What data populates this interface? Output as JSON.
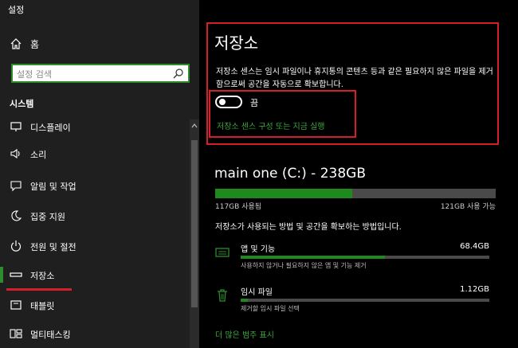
{
  "window": {
    "title": "설정"
  },
  "sidebar": {
    "home_label": "홈",
    "search_placeholder": "설정 검색",
    "section_title": "시스템",
    "items": [
      {
        "label": "디스플레이",
        "icon": "display-icon"
      },
      {
        "label": "소리",
        "icon": "speaker-icon"
      },
      {
        "label": "알림 및 작업",
        "icon": "notification-icon"
      },
      {
        "label": "집중 지원",
        "icon": "moon-icon"
      },
      {
        "label": "전원 및 절전",
        "icon": "power-icon"
      },
      {
        "label": "저장소",
        "icon": "storage-icon",
        "selected": true
      },
      {
        "label": "태블릿",
        "icon": "tablet-icon"
      },
      {
        "label": "멀티태스킹",
        "icon": "multitask-icon"
      }
    ]
  },
  "main": {
    "title": "저장소",
    "description": "저장소 센스는 임시 파일이나 휴지통의 콘텐츠 등과 같은 필요하지 않은 파일을 제거함으로써 공간을 자동으로 확보합니다.",
    "toggle": {
      "label": "끔",
      "on": false
    },
    "config_link": "저장소 센스 구성 또는 지금 실행",
    "drive": {
      "title": "main one (C:) - 238GB",
      "used_label": "117GB 사용됨",
      "free_label": "121GB 사용 가능",
      "used_fraction": 0.49
    },
    "usage_description": "저장소가 사용되는 방법 및 공간을 확보하는 방법입니다.",
    "categories": [
      {
        "name": "앱 및 기능",
        "size": "68.4GB",
        "sub": "사용하지 않거나 필요하지 않은 앱 및 기능 제거",
        "fraction": 0.58,
        "icon": "apps-icon"
      },
      {
        "name": "임시 파일",
        "size": "1.12GB",
        "sub": "제거할 임시 파일 선택",
        "fraction": 0.03,
        "icon": "trash-icon"
      }
    ],
    "more_link": "더 많은 범주 표시"
  },
  "colors": {
    "accent": "#2e8b2e",
    "annotation": "#d21f2b",
    "sidebar_bg": "#1f1f1f"
  }
}
